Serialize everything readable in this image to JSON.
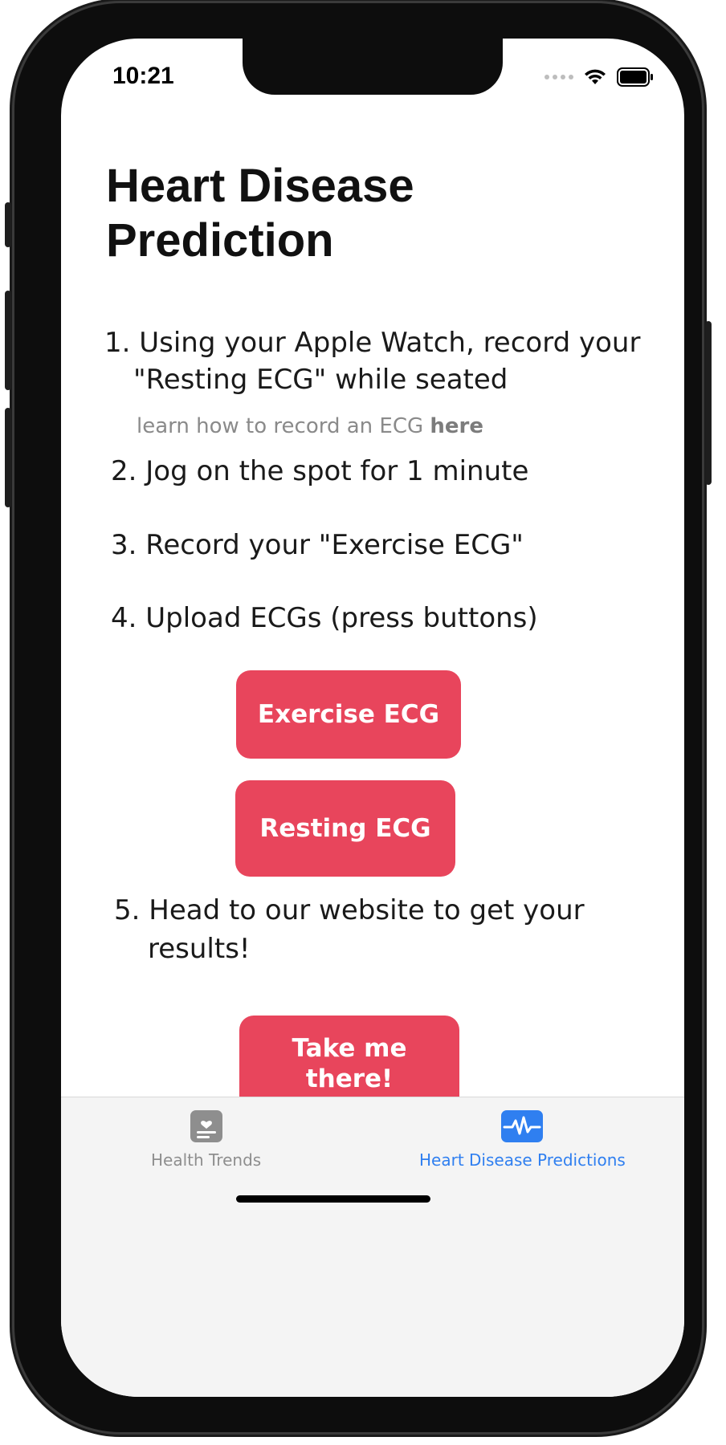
{
  "status_bar": {
    "time": "10:21"
  },
  "page": {
    "title": "Heart Disease Prediction"
  },
  "steps": [
    {
      "number": "1.",
      "text_line1": "Using your Apple Watch, record your",
      "text_line2": "\"Resting ECG\" while seated"
    },
    {
      "number": "2.",
      "text": "Jog on the spot for 1 minute"
    },
    {
      "number": "3.",
      "text": "Record your \"Exercise ECG\""
    },
    {
      "number": "4.",
      "text": "Upload ECGs (press buttons)"
    },
    {
      "number": "5.",
      "text_line1": "Head to our website to get your",
      "text_line2": "results!"
    }
  ],
  "hint": {
    "prefix": "learn how to record an ECG ",
    "link": "here"
  },
  "buttons": {
    "exercise_ecg": "Exercise ECG",
    "resting_ecg": "Resting ECG",
    "take_me_there_line1": "Take me",
    "take_me_there_line2": "there!"
  },
  "tabs": [
    {
      "label": "Health Trends",
      "icon": "health-trends-icon",
      "active": false
    },
    {
      "label": "Heart Disease Predictions",
      "icon": "ecg-waveform-icon",
      "active": true
    }
  ],
  "colors": {
    "accent_button": "#e8455c",
    "tab_active": "#2f7ff0",
    "tab_inactive": "#8e8e8e"
  }
}
